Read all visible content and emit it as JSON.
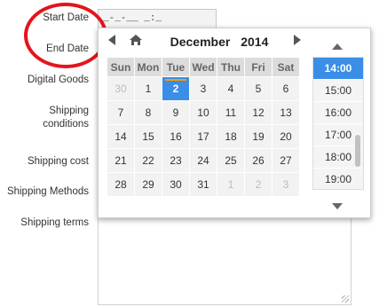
{
  "form": {
    "labels": {
      "start_date": "Start Date",
      "end_date": "End Date",
      "digital_goods": "Digital Goods",
      "shipping_conditions": "Shipping conditions",
      "shipping_cost": "Shipping cost",
      "shipping_methods": "Shipping Methods",
      "shipping_terms": "Shipping terms"
    },
    "start_date_value": "_-_-__ _:_"
  },
  "picker": {
    "month": "December",
    "year": "2014",
    "weekdays": [
      "Sun",
      "Mon",
      "Tue",
      "Wed",
      "Thu",
      "Fri",
      "Sat"
    ],
    "weeks": [
      [
        {
          "d": "30",
          "other": true
        },
        {
          "d": "1"
        },
        {
          "d": "2",
          "today": true
        },
        {
          "d": "3"
        },
        {
          "d": "4"
        },
        {
          "d": "5"
        },
        {
          "d": "6"
        }
      ],
      [
        {
          "d": "7"
        },
        {
          "d": "8"
        },
        {
          "d": "9"
        },
        {
          "d": "10"
        },
        {
          "d": "11"
        },
        {
          "d": "12"
        },
        {
          "d": "13"
        }
      ],
      [
        {
          "d": "14"
        },
        {
          "d": "15"
        },
        {
          "d": "16"
        },
        {
          "d": "17"
        },
        {
          "d": "18"
        },
        {
          "d": "19"
        },
        {
          "d": "20"
        }
      ],
      [
        {
          "d": "21"
        },
        {
          "d": "22"
        },
        {
          "d": "23"
        },
        {
          "d": "24"
        },
        {
          "d": "25"
        },
        {
          "d": "26"
        },
        {
          "d": "27"
        }
      ],
      [
        {
          "d": "28"
        },
        {
          "d": "29"
        },
        {
          "d": "30"
        },
        {
          "d": "31"
        },
        {
          "d": "1",
          "other": true
        },
        {
          "d": "2",
          "other": true
        },
        {
          "d": "3",
          "other": true
        }
      ]
    ],
    "times": [
      "14:00",
      "15:00",
      "16:00",
      "17:00",
      "18:00",
      "19:00"
    ],
    "selected_time": "14:00",
    "icons": {
      "prev": "triangle-left-icon",
      "home": "home-icon",
      "next": "triangle-right-icon",
      "time_up": "triangle-up-icon",
      "time_down": "triangle-down-icon"
    }
  },
  "colors": {
    "accent": "#3a8ee6",
    "today_marker": "#ff9800",
    "annotation_circle": "#e3141c"
  }
}
